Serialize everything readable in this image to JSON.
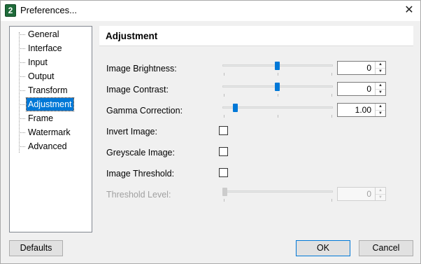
{
  "window": {
    "title": "Preferences...",
    "app_icon_glyph": "2",
    "close_glyph": "✕"
  },
  "tree": {
    "items": [
      {
        "label": "General",
        "selected": false
      },
      {
        "label": "Interface",
        "selected": false
      },
      {
        "label": "Input",
        "selected": false
      },
      {
        "label": "Output",
        "selected": false
      },
      {
        "label": "Transform",
        "selected": false
      },
      {
        "label": "Adjustment",
        "selected": true
      },
      {
        "label": "Frame",
        "selected": false
      },
      {
        "label": "Watermark",
        "selected": false
      },
      {
        "label": "Advanced",
        "selected": false
      }
    ]
  },
  "panel": {
    "title": "Adjustment",
    "brightness": {
      "label": "Image Brightness:",
      "value": "0",
      "level": 0.5
    },
    "contrast": {
      "label": "Image Contrast:",
      "value": "0",
      "level": 0.5
    },
    "gamma": {
      "label": "Gamma Correction:",
      "value": "1.00",
      "level": 0.12
    },
    "invert": {
      "label": "Invert Image:",
      "checked": false
    },
    "greyscale": {
      "label": "Greyscale Image:",
      "checked": false
    },
    "threshold": {
      "label": "Image Threshold:",
      "checked": false
    },
    "threshold_level": {
      "label": "Threshold Level:",
      "value": "0",
      "level": 0.0,
      "enabled": false
    }
  },
  "buttons": {
    "defaults": "Defaults",
    "ok": "OK",
    "cancel": "Cancel"
  },
  "colors": {
    "accent": "#0078d7",
    "selection": "#0078d7"
  }
}
